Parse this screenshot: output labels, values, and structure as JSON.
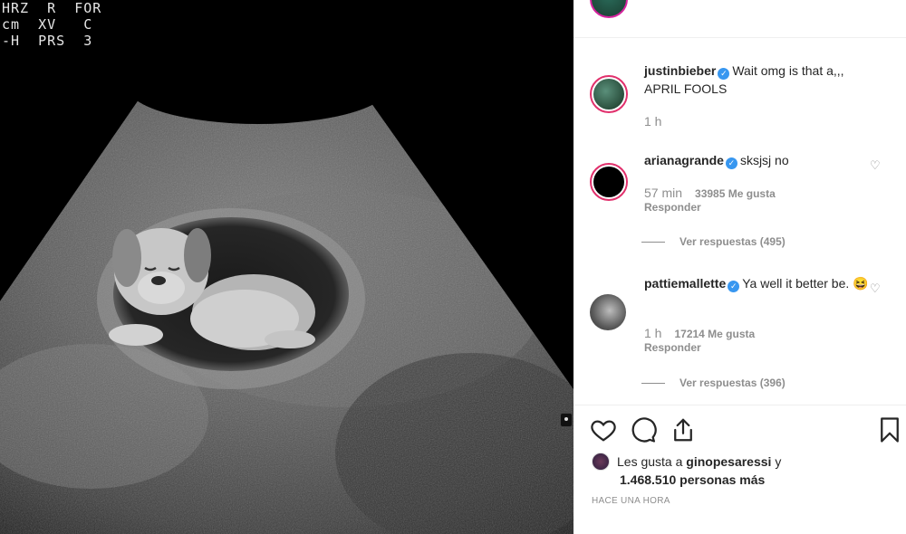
{
  "media": {
    "overlay_lines": [
      "HRZ  R  FOR",
      "cm  XV   C",
      "-H  PRS  3"
    ]
  },
  "comments": [
    {
      "username": "justinbieber",
      "verified": true,
      "text": "Wait omg is that a,,, APRIL FOOLS",
      "time": "1 h"
    },
    {
      "username": "arianagrande",
      "verified": true,
      "text": "sksjsj no",
      "time": "57 min",
      "likes": "33985 Me gusta",
      "reply_label": "Responder",
      "view_replies": "Ver respuestas (495)"
    },
    {
      "username": "pattiemallette",
      "verified": true,
      "text": "Ya well it better be. 😆",
      "time": "1 h",
      "likes": "17214 Me gusta",
      "reply_label": "Responder",
      "view_replies": "Ver respuestas (396)"
    }
  ],
  "footer": {
    "liked_by_prefix": "Les gusta a ",
    "liked_by_user": "ginopesaressi",
    "liked_by_suffix": " y",
    "liked_count": "1.468.510 personas más",
    "date": "HACE UNA HORA"
  },
  "icons": {
    "verified": "verified-badge-icon",
    "like": "heart-icon",
    "comment": "comment-bubble-icon",
    "share": "share-icon",
    "save": "bookmark-icon"
  },
  "colors": {
    "verified": "#3897f0",
    "text": "#262626",
    "secondary": "#8e8e8e",
    "story_ring": "#e1306c"
  }
}
